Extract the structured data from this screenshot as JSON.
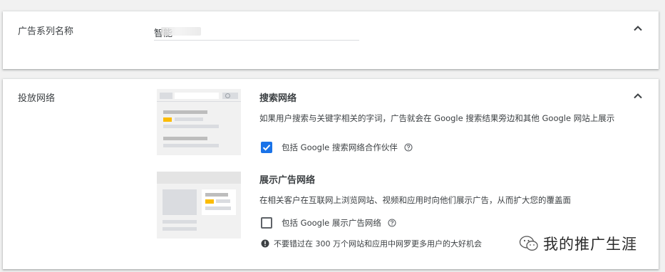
{
  "campaign_name": {
    "label": "广告系列名称",
    "value": "智能"
  },
  "networks": {
    "label": "投放网络",
    "search": {
      "title": "搜索网络",
      "description": "如果用户搜索与关键字相关的字词，广告就会在 Google 搜索结果旁边和其他 Google 网站上展示",
      "checkbox_label": "包括 Google 搜索网络合作伙伴",
      "checked": true
    },
    "display": {
      "title": "展示广告网络",
      "description": "在相关客户在互联网上浏览网站、视频和应用时向他们展示广告，从而扩大您的覆盖面",
      "checkbox_label": "包括 Google 展示广告网络",
      "checked": false,
      "warning": "不要错过在 300 万个网站和应用中网罗更多用户的大好机会"
    }
  },
  "watermark": {
    "text": "我的推广生涯"
  },
  "colors": {
    "accent": "#1a73e8",
    "highlight": "#fbbc04",
    "text": "#3c4043"
  }
}
